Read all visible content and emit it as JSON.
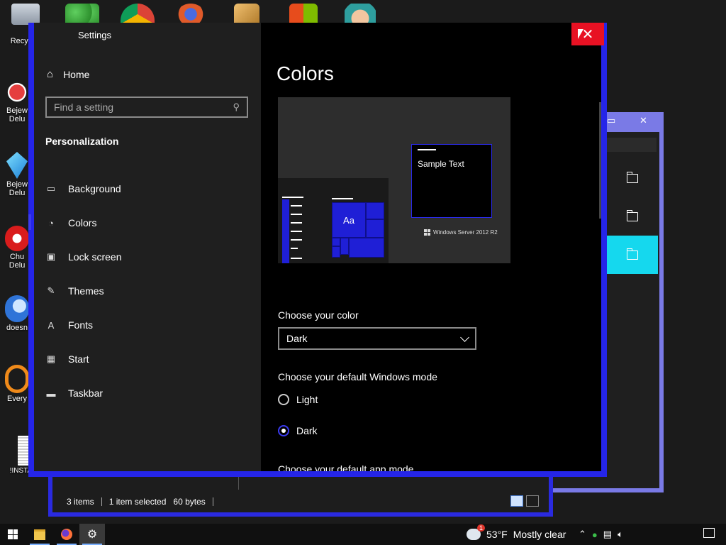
{
  "desktop": {
    "icons": [
      {
        "label": "Recyc",
        "icon": "recycle-bin-icon"
      },
      {
        "label": "Bejew Delu",
        "icon": "bejeweled-icon"
      },
      {
        "label": "Bejew Delu",
        "icon": "bejeweled-blue-icon"
      },
      {
        "label": "Chu Delu",
        "icon": "chuzzle-icon"
      },
      {
        "label": "doesn",
        "icon": "app-icon"
      },
      {
        "label": "Every",
        "icon": "everything-icon"
      },
      {
        "label": "!INSTALL",
        "icon": "text-file-icon"
      }
    ]
  },
  "explorer": {
    "status": {
      "items": "3 items",
      "selected": "1 item selected",
      "size": "60 bytes"
    },
    "titlebar": {
      "restore": "▭",
      "close": "✕"
    }
  },
  "settings": {
    "window_title": "Settings",
    "close_glyph": "✕",
    "home_label": "Home",
    "search_placeholder": "Find a setting",
    "section_header": "Personalization",
    "nav": [
      {
        "label": "Background",
        "icon": "image-icon"
      },
      {
        "label": "Colors",
        "icon": "palette-icon"
      },
      {
        "label": "Lock screen",
        "icon": "lock-screen-icon"
      },
      {
        "label": "Themes",
        "icon": "themes-icon"
      },
      {
        "label": "Fonts",
        "icon": "fonts-icon"
      },
      {
        "label": "Start",
        "icon": "start-icon"
      },
      {
        "label": "Taskbar",
        "icon": "taskbar-icon"
      }
    ],
    "active_nav": "Colors",
    "page_title": "Colors",
    "preview": {
      "sample_text": "Sample Text",
      "tile_text": "Aa",
      "brand": "Windows Server 2012 R2"
    },
    "choose_color_label": "Choose your color",
    "choose_color_value": "Dark",
    "windows_mode_label": "Choose your default Windows mode",
    "mode_options": [
      {
        "label": "Light",
        "checked": false
      },
      {
        "label": "Dark",
        "checked": true
      }
    ],
    "app_mode_label": "Choose your default app mode",
    "accent_color": "#2525e8"
  },
  "taskbar": {
    "weather_temp": "53°F",
    "weather_text": "Mostly clear",
    "weather_badge": "1",
    "apps": [
      {
        "name": "start-button",
        "icon": "windows-logo-icon"
      },
      {
        "name": "file-explorer",
        "icon": "folder-icon"
      },
      {
        "name": "firefox",
        "icon": "firefox-icon"
      },
      {
        "name": "settings",
        "icon": "gear-icon"
      }
    ]
  }
}
